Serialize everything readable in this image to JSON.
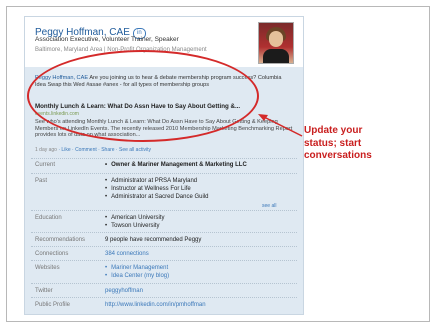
{
  "profile": {
    "name": "Peggy Hoffman, CAE",
    "headline": "Association Executive, Volunteer Trainer, Speaker",
    "location": "Baltimore, Maryland Area",
    "industry": "Non-Profit Organization Management",
    "in_badge": "in"
  },
  "status": {
    "name": "Peggy Hoffman, CAE",
    "text": "Are you joining us to hear & debate membership program success? Columbia Idea Swap this Wed #asae #anex - for all types of membership groups",
    "share_title": "Monthly Lunch & Learn: What Do Assn Have to Say About Getting &...",
    "share_url": "events.linkedin.com",
    "share_desc": "See who's attending Monthly Lunch & Learn: What Do Assn Have to Say About Getting & Keeping Members on LinkedIn Events. The recently released 2010 Membership Marketing Benchmarking Report provides lots of data on what association...",
    "time_ago": "1 day ago",
    "actions": [
      "Like",
      "Comment",
      "Share",
      "See all activity"
    ]
  },
  "details": {
    "current": {
      "label": "Current",
      "items": [
        "Owner & Mariner Management & Marketing LLC"
      ]
    },
    "past": {
      "label": "Past",
      "items": [
        "Administrator at PRSA Maryland",
        "Instructor at Wellness For Life",
        "Administrator at Sacred Dance Guild"
      ],
      "see_all": "see all"
    },
    "education": {
      "label": "Education",
      "items": [
        "American University",
        "Towson University"
      ]
    },
    "recommendations": {
      "label": "Recommendations",
      "value": "9 people have recommended Peggy"
    },
    "connections": {
      "label": "Connections",
      "value": "384 connections"
    },
    "websites": {
      "label": "Websites",
      "items": [
        "Mariner Management",
        "Idea Center (my blog)"
      ]
    },
    "twitter": {
      "label": "Twitter",
      "value": "peggyhoffman"
    },
    "public_profile": {
      "label": "Public Profile",
      "value": "http://www.linkedin.com/in/pmhoffman"
    }
  },
  "callout": {
    "line1": "Update your",
    "line2": "status; start",
    "line3": "conversations"
  },
  "colors": {
    "callout_red": "#d42a2a",
    "link_blue": "#3b78b9",
    "card_bg": "#dfe9f2"
  }
}
